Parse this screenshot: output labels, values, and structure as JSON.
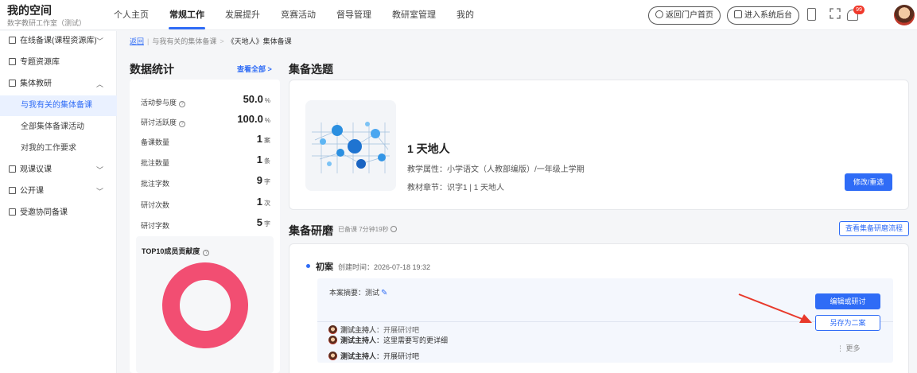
{
  "brand": {
    "title": "我的空间",
    "subtitle": "数字教研工作室（测试）"
  },
  "nav": {
    "items": [
      {
        "label": "个人主页"
      },
      {
        "label": "常规工作"
      },
      {
        "label": "发展提升"
      },
      {
        "label": "竞赛活动"
      },
      {
        "label": "督导管理"
      },
      {
        "label": "教研室管理"
      },
      {
        "label": "我的"
      }
    ],
    "active_index": 1,
    "portal_button": "返回门户首页",
    "backend_button": "进入系统后台",
    "notification_count": "99"
  },
  "sidebar": {
    "items": [
      {
        "label": "在线备课(课程资源库)",
        "chevron": "﹀"
      },
      {
        "label": "专题资源库",
        "chevron": ""
      },
      {
        "label": "集体教研",
        "chevron": "︿"
      },
      {
        "label": "与我有关的集体备课",
        "chevron": ""
      },
      {
        "label": "全部集体备课活动",
        "chevron": ""
      },
      {
        "label": "对我的工作要求",
        "chevron": ""
      },
      {
        "label": "观课议课",
        "chevron": "﹀"
      },
      {
        "label": "公开课",
        "chevron": "﹀"
      },
      {
        "label": "受邀协同备课",
        "chevron": ""
      }
    ]
  },
  "breadcrumb": {
    "back": "返回",
    "parent": "与我有关的集体备课",
    "current": "《天地人》集体备课"
  },
  "stats": {
    "title": "数据统计",
    "view_all": "查看全部 >",
    "rows": [
      {
        "label": "活动参与度",
        "help": "?",
        "value": "50.0",
        "unit": "%"
      },
      {
        "label": "研讨活跃度",
        "help": "?",
        "value": "100.0",
        "unit": "%"
      },
      {
        "label": "备课数量",
        "help": "",
        "value": "1",
        "unit": "案"
      },
      {
        "label": "批注数量",
        "help": "",
        "value": "1",
        "unit": "条"
      },
      {
        "label": "批注字数",
        "help": "",
        "value": "9",
        "unit": "字"
      },
      {
        "label": "研讨次数",
        "help": "",
        "value": "1",
        "unit": "次"
      },
      {
        "label": "研讨字数",
        "help": "",
        "value": "5",
        "unit": "字"
      }
    ],
    "top10_title": "TOP10成员贡献度",
    "top10_help": "?",
    "donut_color": "#f24e72",
    "donut_share": 1.0
  },
  "selection": {
    "title": "集备选题",
    "lesson_title": "1 天地人",
    "attribute": "教学属性：小学语文（人教部编版）/一年级上学期",
    "chapter": "教材章节：识字1 | 1 天地人",
    "modify_button": "修改/重选"
  },
  "research": {
    "title": "集备研磨",
    "duration": "已备课 7分钟19秒",
    "flow_button": "查看集备研磨流程",
    "draft_title": "初案",
    "created": "创建时间：2026-07-18  19:32",
    "summary": "本案摘要：测试",
    "edit_button": "编辑或研讨",
    "save_as_button": "另存为二案",
    "comments": [
      {
        "author": "测试主持人",
        "text": "：这里需要写的更详细"
      },
      {
        "author": "测试主持人",
        "text": "：开展研讨吧"
      }
    ],
    "more": "⋮ 更多"
  },
  "colors": {
    "accent": "#2f6cf6",
    "arrow": "#e8392b"
  }
}
